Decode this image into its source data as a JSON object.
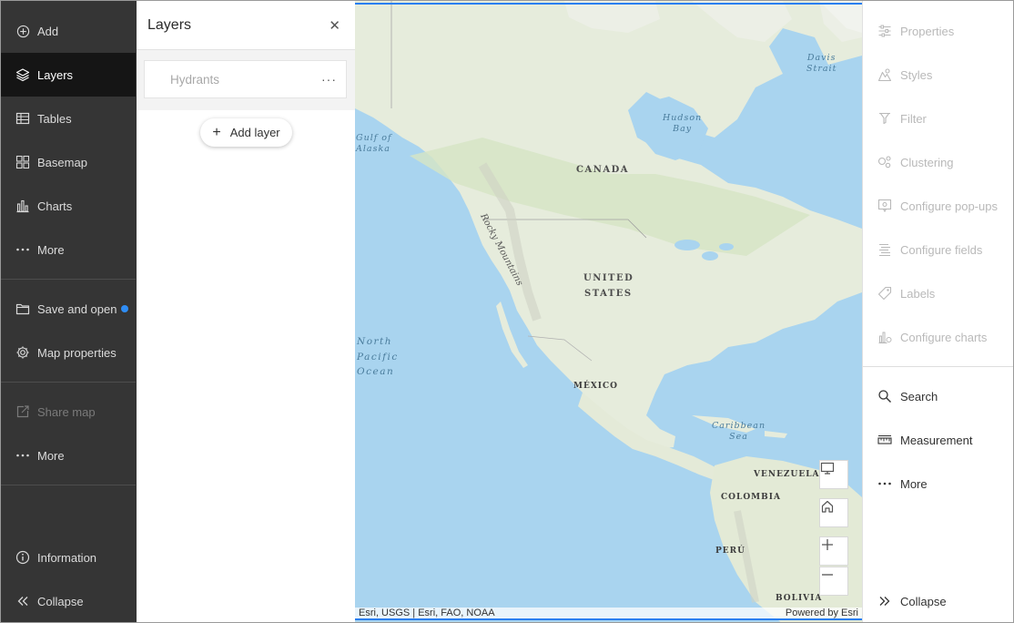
{
  "leftnav": {
    "items": [
      {
        "label": "Add",
        "icon": "plus-circle-icon"
      },
      {
        "label": "Layers",
        "icon": "layers-icon"
      },
      {
        "label": "Tables",
        "icon": "table-icon"
      },
      {
        "label": "Basemap",
        "icon": "basemap-icon"
      },
      {
        "label": "Charts",
        "icon": "chart-icon"
      },
      {
        "label": "More",
        "icon": "ellipsis-icon"
      },
      {
        "label": "Save and open",
        "icon": "folder-icon"
      },
      {
        "label": "Map properties",
        "icon": "gear-icon"
      },
      {
        "label": "Share map",
        "icon": "share-icon"
      },
      {
        "label": "More",
        "icon": "ellipsis-icon"
      },
      {
        "label": "Information",
        "icon": "info-icon"
      },
      {
        "label": "Collapse",
        "icon": "chevrons-left-icon"
      }
    ],
    "active": "Layers",
    "badge_color": "#2f8df5"
  },
  "layers_panel": {
    "title": "Layers",
    "close_symbol": "✕",
    "layers": [
      {
        "name": "Hydrants"
      }
    ],
    "layer_menu_symbol": "···",
    "add_layer_label": "Add layer",
    "add_layer_symbol": "+"
  },
  "map": {
    "labels": {
      "canada": "CANADA",
      "us_line1": "UNITED",
      "us_line2": "STATES",
      "mexico": "MÉXICO",
      "venezuela": "VENEZUELA",
      "colombia": "COLOMBIA",
      "peru": "PERÚ",
      "bolivia": "BOLIVIA",
      "rocky": "Rocky Mountains",
      "hudson1": "Hudson",
      "hudson2": "Bay",
      "davis1": "Davis",
      "davis2": "Strait",
      "gulf1": "Gulf of",
      "gulf2": "Alaska",
      "pacific1": "North",
      "pacific2": "Pacific",
      "pacific3": "Ocean",
      "caribbean1": "Caribbean",
      "caribbean2": "Sea"
    },
    "attribution_left": "Esri, USGS | Esri, FAO, NOAA",
    "attribution_right": "Powered by Esri",
    "controls": [
      {
        "name": "screen-icon"
      },
      {
        "name": "home-icon"
      },
      {
        "name": "zoom-in-icon"
      },
      {
        "name": "zoom-out-icon"
      }
    ],
    "accent": "#2a7ff0"
  },
  "rightnav": {
    "items": [
      {
        "label": "Properties",
        "icon": "sliders-icon",
        "disabled": true
      },
      {
        "label": "Styles",
        "icon": "styles-icon",
        "disabled": true
      },
      {
        "label": "Filter",
        "icon": "filter-icon",
        "disabled": true
      },
      {
        "label": "Clustering",
        "icon": "clustering-icon",
        "disabled": true
      },
      {
        "label": "Configure pop-ups",
        "icon": "popup-icon",
        "disabled": true
      },
      {
        "label": "Configure fields",
        "icon": "fields-icon",
        "disabled": true
      },
      {
        "label": "Labels",
        "icon": "label-icon",
        "disabled": true
      },
      {
        "label": "Configure charts",
        "icon": "chart-config-icon",
        "disabled": true
      },
      {
        "label": "Search",
        "icon": "search-icon",
        "disabled": false
      },
      {
        "label": "Measurement",
        "icon": "ruler-icon",
        "disabled": false
      },
      {
        "label": "More",
        "icon": "ellipsis-icon",
        "disabled": false
      },
      {
        "label": "Collapse",
        "icon": "chevrons-right-icon",
        "disabled": false
      }
    ]
  }
}
